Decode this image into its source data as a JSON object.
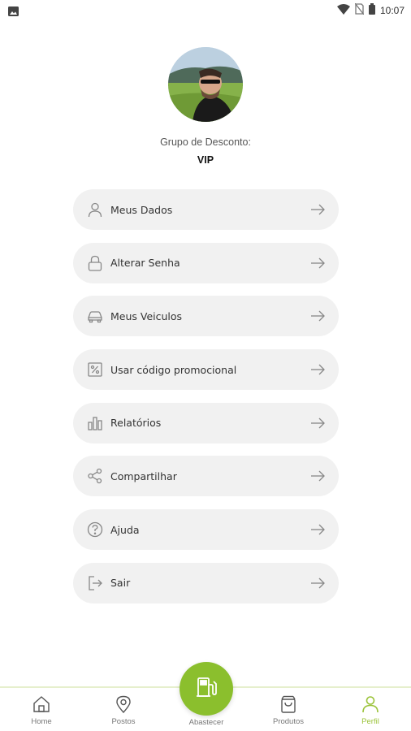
{
  "status_bar": {
    "time": "10:07",
    "icons": [
      "image-notification-icon",
      "wifi-icon",
      "no-sim-icon",
      "battery-icon"
    ]
  },
  "profile": {
    "group_label": "Grupo de Desconto:",
    "group_value": "VIP"
  },
  "menu": {
    "items": [
      {
        "label": "Meus Dados",
        "icon": "user-icon"
      },
      {
        "label": "Alterar Senha",
        "icon": "lock-icon"
      },
      {
        "label": "Meus Veiculos",
        "icon": "car-icon"
      },
      {
        "label": "Usar código promocional",
        "icon": "percent-icon"
      },
      {
        "label": "Relatórios",
        "icon": "bar-chart-icon"
      },
      {
        "label": "Compartilhar",
        "icon": "share-icon"
      },
      {
        "label": "Ajuda",
        "icon": "help-icon"
      },
      {
        "label": "Sair",
        "icon": "logout-icon"
      }
    ]
  },
  "bottom_nav": {
    "items": [
      {
        "label": "Home",
        "icon": "home-icon"
      },
      {
        "label": "Postos",
        "icon": "location-pin-icon"
      },
      {
        "label": "Abastecer",
        "icon": "fuel-pump-icon"
      },
      {
        "label": "Produtos",
        "icon": "shopping-bag-icon"
      },
      {
        "label": "Perfil",
        "icon": "profile-icon",
        "active": true
      }
    ]
  },
  "colors": {
    "accent": "#8bbf2d",
    "active_nav": "#9bc33a",
    "menu_bg": "#f1f1f1"
  }
}
